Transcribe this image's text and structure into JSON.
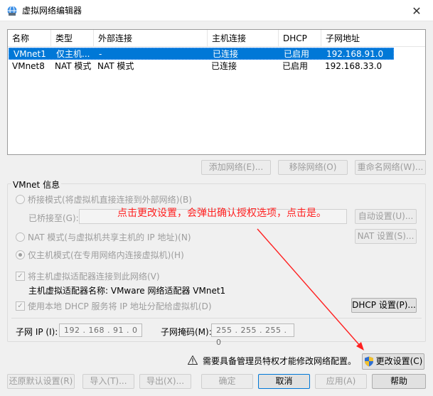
{
  "window": {
    "title": "虚拟网络编辑器",
    "close_glyph": "✕"
  },
  "table": {
    "headers": [
      "名称",
      "类型",
      "外部连接",
      "主机连接",
      "DHCP",
      "子网地址"
    ],
    "rows": [
      [
        "VMnet1",
        "仅主机...",
        "-",
        "已连接",
        "已启用",
        "192.168.91.0"
      ],
      [
        "VMnet8",
        "NAT 模式",
        "NAT 模式",
        "已连接",
        "已启用",
        "192.168.33.0"
      ]
    ]
  },
  "network_buttons": {
    "add": "添加网络(E)...",
    "remove": "移除网络(O)",
    "rename": "重命名网络(W)..."
  },
  "vmnet_info": {
    "legend": "VMnet 信息",
    "bridged_label": "桥接模式(将虚拟机直接连接到外部网络)(B)",
    "bridged_to_label": "已桥接至(G):",
    "auto_settings": "自动设置(U)...",
    "nat_label": "NAT 模式(与虚拟机共享主机的 IP 地址)(N)",
    "nat_settings": "NAT 设置(S)...",
    "host_only_label": "仅主机模式(在专用网络内连接虚拟机)(H)",
    "connect_adapter_label": "将主机虚拟适配器连接到此网络(V)",
    "adapter_name_label": "主机虚拟适配器名称: VMware 网络适配器 VMnet1",
    "use_dhcp_label": "使用本地 DHCP 服务将 IP 地址分配给虚拟机(D)",
    "dhcp_settings": "DHCP 设置(P)...",
    "subnet_ip_label": "子网 IP (I):",
    "subnet_ip_value": "192 . 168 . 91 . 0",
    "subnet_mask_label": "子网掩码(M):",
    "subnet_mask_value": "255 . 255 . 255 . 0"
  },
  "annotation": "点击更改设置，会弹出确认授权选项，点击是。",
  "admin_notice": "需要具备管理员特权才能修改网络配置。",
  "change_settings": "更改设置(C)",
  "footer": {
    "restore_defaults": "还原默认设置(R)",
    "import": "导入(T)...",
    "export": "导出(X)...",
    "ok": "确定",
    "cancel": "取消",
    "apply": "应用(A)",
    "help": "帮助"
  },
  "colors": {
    "selection": "#0078d7",
    "annotation": "#ff2020",
    "disabled_text": "#9d9d9d"
  }
}
